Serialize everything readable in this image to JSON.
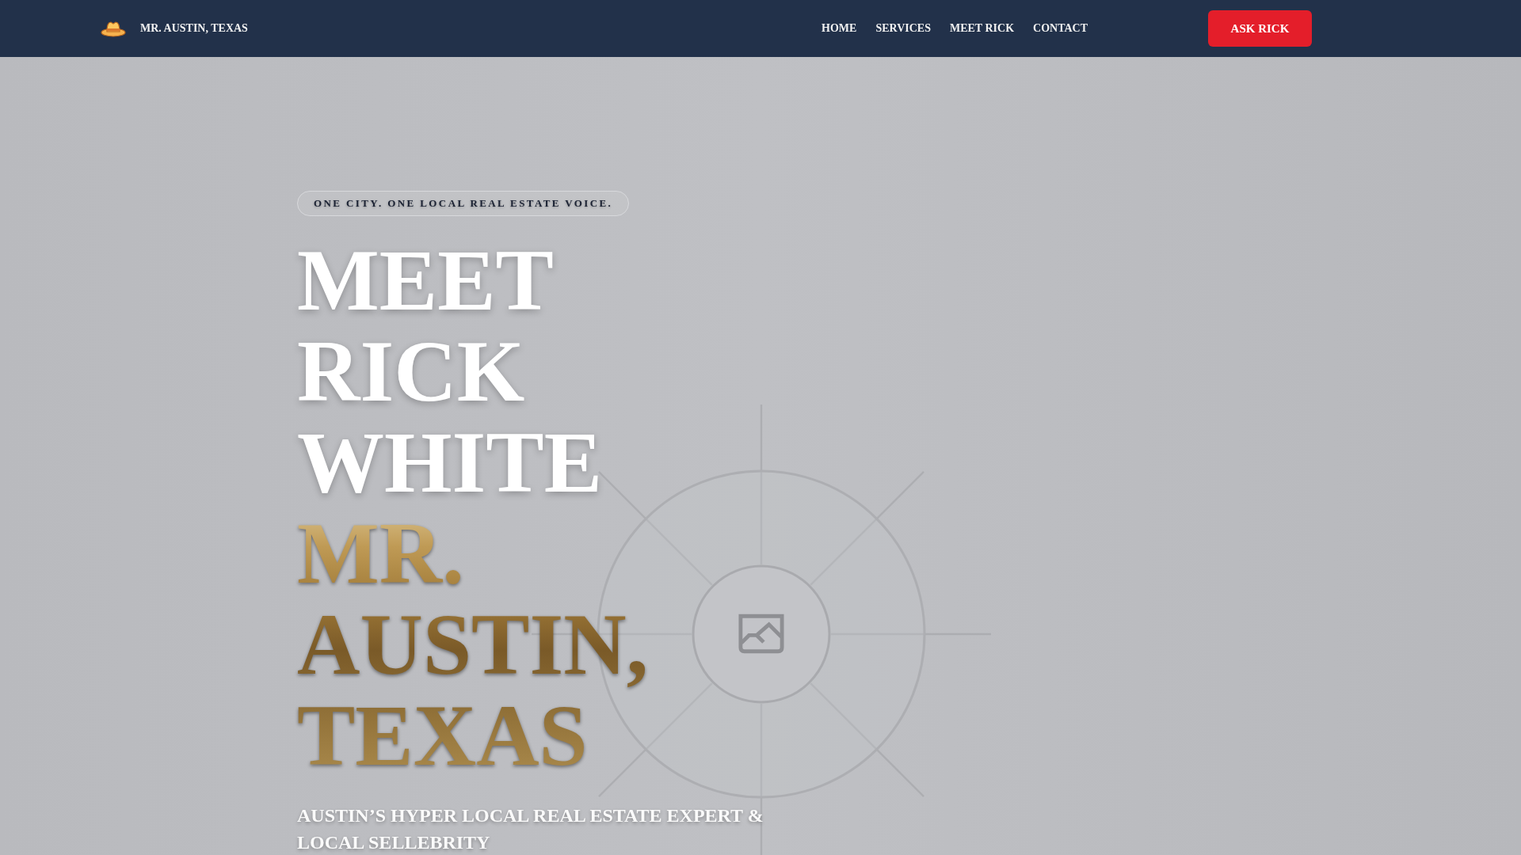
{
  "header": {
    "brand": "MR. AUSTIN, TEXAS",
    "nav": [
      {
        "label": "HOME"
      },
      {
        "label": "SERVICES"
      },
      {
        "label": "MEET RICK"
      },
      {
        "label": "CONTACT"
      }
    ],
    "cta": "ASK RICK"
  },
  "hero": {
    "tagline": "ONE CITY. ONE LOCAL REAL ESTATE VOICE.",
    "headline": "MEET RICK WHITE",
    "headline_accent": "MR. AUSTIN, TEXAS",
    "subtitle": "AUSTIN’S HYPER LOCAL REAL ESTATE EXPERT & LOCAL SELLEBRITY"
  }
}
